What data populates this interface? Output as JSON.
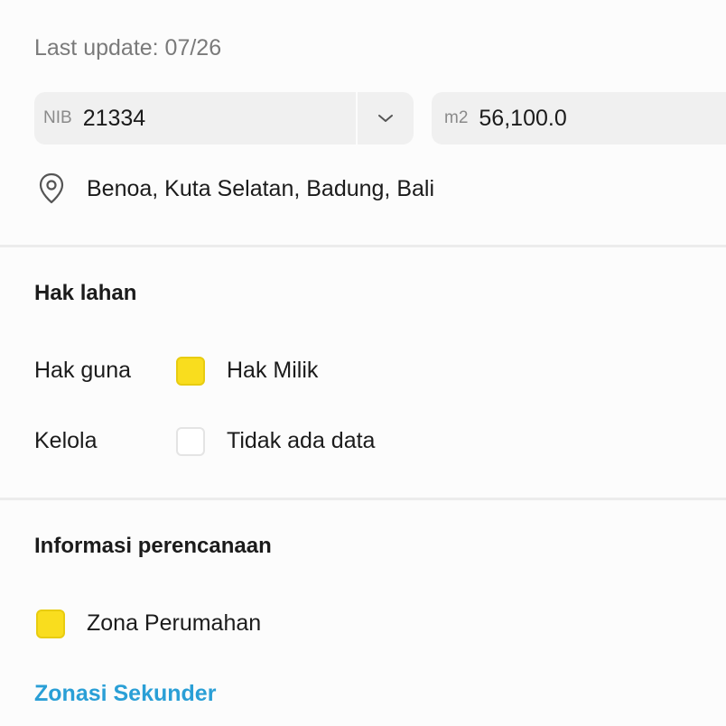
{
  "header": {
    "last_update": "Last update: 07/26"
  },
  "fields": {
    "nib": {
      "prefix": "NIB",
      "value": "21334"
    },
    "area": {
      "prefix": "m2",
      "value": "56,100.0"
    }
  },
  "location": {
    "text": "Benoa, Kuta Selatan, Badung, Bali"
  },
  "hak_lahan": {
    "title": "Hak lahan",
    "rows": [
      {
        "label": "Hak guna",
        "value": "Hak Milik",
        "swatch_color": "#f9dd1e"
      },
      {
        "label": "Kelola",
        "value": "Tidak ada data",
        "swatch_color": "#ffffff"
      }
    ]
  },
  "perencanaan": {
    "title": "Informasi perencanaan",
    "zona": {
      "label": "Zona Perumahan",
      "swatch_color": "#f9dd1e"
    },
    "link": "Zonasi Sekunder"
  },
  "colors": {
    "accent_link": "#2a9fd6",
    "swatch_yellow": "#f9dd1e"
  },
  "icons": {
    "location": "map-pin-icon",
    "dropdown": "chevron-down-icon"
  }
}
